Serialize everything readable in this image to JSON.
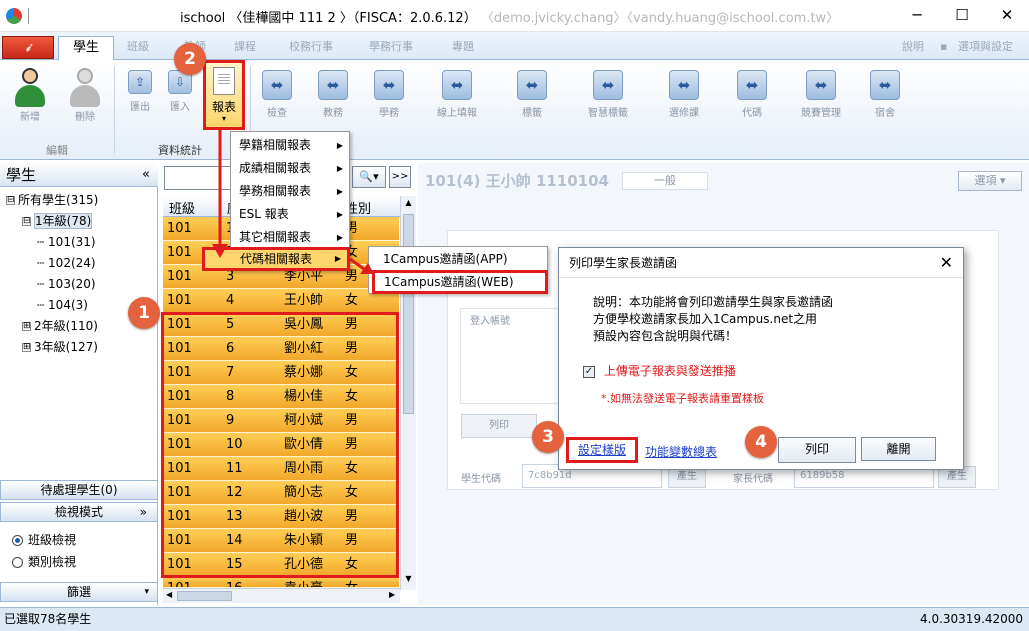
{
  "window": {
    "title": "ischool 〈佳樺國中 111 2 〉（FISCA：2.0.6.12）",
    "title_blur": "〈demo.jvicky.chang〉〈vandy.huang@ischool.com.tw〉",
    "min": "─",
    "max": "☐",
    "close": "✕"
  },
  "ribbon": {
    "tabs": [
      "學生",
      "班級",
      "教師",
      "課程",
      "校務行事",
      "學務行事",
      "專題"
    ],
    "right_items": [
      "說明",
      "▪",
      "選項與設定"
    ],
    "buttons": [
      "新增",
      "刪除",
      "匯出",
      "匯入",
      "報表",
      "檢查",
      "教務",
      "學務",
      "線上填報",
      "標籤",
      "智慧標籤",
      "選修課",
      "代碼",
      "競賽管理",
      "宿舍"
    ],
    "group_labels": [
      "編輯",
      "資料統計"
    ]
  },
  "left": {
    "header": "學生",
    "collapse": "«",
    "tree": [
      {
        "label": "所有學生(315)",
        "box": "⊟"
      },
      {
        "label": "1年級(78)",
        "box": "⊟"
      },
      {
        "label": "101(31)"
      },
      {
        "label": "102(24)"
      },
      {
        "label": "103(20)"
      },
      {
        "label": "104(3)"
      },
      {
        "label": "2年級(110)",
        "box": "⊞"
      },
      {
        "label": "3年級(127)",
        "box": "⊞"
      }
    ],
    "pending": "待處理學生(0)",
    "view_mode": "檢視模式",
    "view_mode_chevron": "»",
    "radio_class": "班級檢視",
    "radio_category": "類別檢視",
    "filter": "篩選"
  },
  "list": {
    "search_icon": "🔍",
    "expand": ">>",
    "columns": [
      "班級",
      "座號",
      "姓名",
      "性別"
    ],
    "rows": [
      [
        "101",
        "1",
        "",
        "男"
      ],
      [
        "101",
        "2",
        "",
        "女"
      ],
      [
        "101",
        "3",
        "李小平",
        "男"
      ],
      [
        "101",
        "4",
        "王小帥",
        "女"
      ],
      [
        "101",
        "5",
        "吳小鳳",
        "男"
      ],
      [
        "101",
        "6",
        "劉小紅",
        "男"
      ],
      [
        "101",
        "7",
        "蔡小娜",
        "女"
      ],
      [
        "101",
        "8",
        "楊小佳",
        "女"
      ],
      [
        "101",
        "9",
        "柯小斌",
        "男"
      ],
      [
        "101",
        "10",
        "歐小倩",
        "男"
      ],
      [
        "101",
        "11",
        "周小雨",
        "女"
      ],
      [
        "101",
        "12",
        "簡小志",
        "女"
      ],
      [
        "101",
        "13",
        "趙小波",
        "男"
      ],
      [
        "101",
        "14",
        "朱小穎",
        "男"
      ],
      [
        "101",
        "15",
        "孔小德",
        "女"
      ],
      [
        "101",
        "16",
        "袁小豪",
        "女"
      ]
    ]
  },
  "menu": {
    "items": [
      "學籍相關報表",
      "成績相關報表",
      "學務相關報表",
      "ESL 報表",
      "其它相關報表",
      "代碼相關報表"
    ],
    "sub_items": [
      "1Campus邀請函(APP)",
      "1Campus邀請函(WEB)"
    ]
  },
  "detail": {
    "header": "101(4) 王小帥 1110104",
    "tab": "一般",
    "btn": "選項",
    "box_label": "登入帳號",
    "field1_label": "學生代碼",
    "field1_value": "7c8b91d",
    "field2_label": "家長代碼",
    "field2_value": "6189b58",
    "gen_btn": "產生",
    "gen_btn2": "產生",
    "left_btn": "列印"
  },
  "dialog": {
    "title": "列印學生家長邀請函",
    "close": "✕",
    "desc1": "說明：本功能將會列印邀請學生與家長邀請函",
    "desc2": "方便學校邀請家長加入1Campus.net之用",
    "desc3": "預設內容包含說明與代碼！",
    "check_mark": "✓",
    "checkbox_label": "上傳電子報表與發送推播",
    "warning": "*.如無法發送電子報表請重置樣板",
    "link_template": "設定樣版",
    "link_fields": "功能變數總表",
    "print": "列印",
    "leave": "離開"
  },
  "badges": [
    "1",
    "2",
    "3",
    "4"
  ],
  "status": {
    "left": "已選取78名學生",
    "right": "4.0.30319.42000"
  },
  "colors": {
    "red_highlight": "#e01b1b",
    "badge": "#e5623e",
    "row_orange": "#f2a72a",
    "ribbon_blue": "#dde8f5",
    "link_blue": "#1a3fc9"
  }
}
